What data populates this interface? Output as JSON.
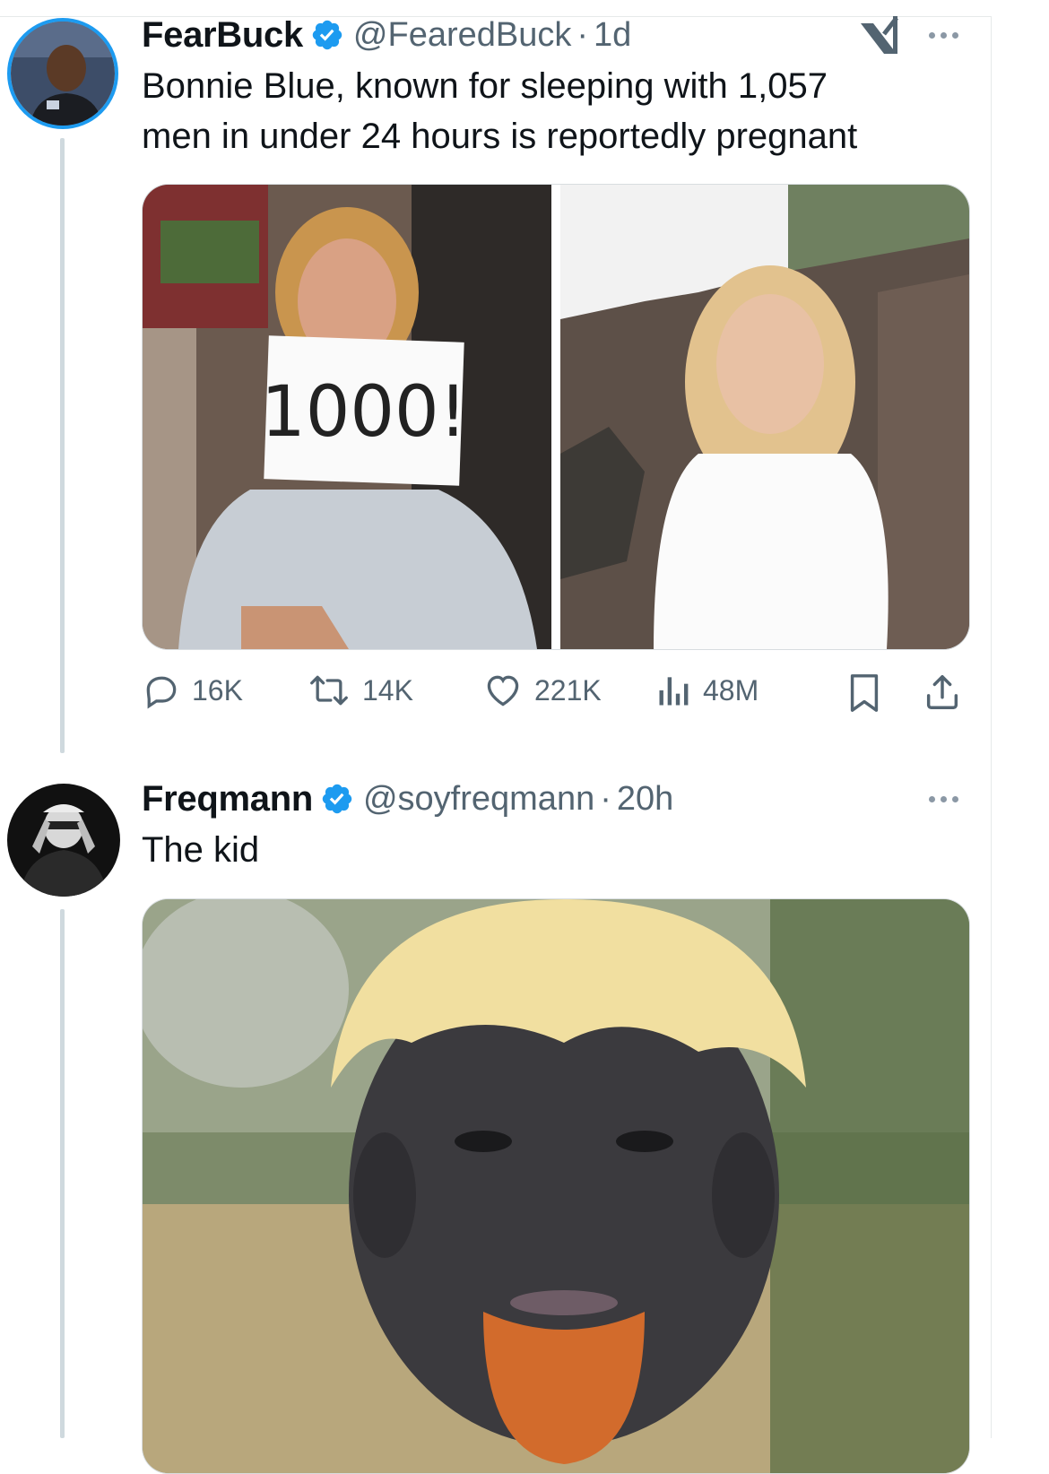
{
  "tweets": [
    {
      "author": "FearBuck",
      "handle": "@FearedBuck",
      "dot": "·",
      "time": "1d",
      "text_lines": [
        "Bonnie Blue, known for sleeping with 1,057",
        "men in under 24 hours is reportedly pregnant"
      ],
      "media": [
        {
          "label": "photo-left",
          "sign_text": "1000!"
        },
        {
          "label": "photo-right"
        }
      ],
      "actions": {
        "replies": "16K",
        "reposts": "14K",
        "likes": "221K",
        "views": "48M"
      },
      "icons": [
        "reply-icon",
        "repost-icon",
        "like-icon",
        "views-icon",
        "bookmark-icon",
        "share-icon",
        "xai-icon",
        "more-icon"
      ]
    },
    {
      "author": "Freqmann",
      "handle": "@soyfreqmann",
      "dot": "·",
      "time": "20h",
      "text": "The kid"
    }
  ],
  "colors": {
    "verified": "#1d9bf0",
    "secondary_text": "#536471",
    "thread_line": "#cfd9de",
    "primary_text": "#0f1419"
  }
}
